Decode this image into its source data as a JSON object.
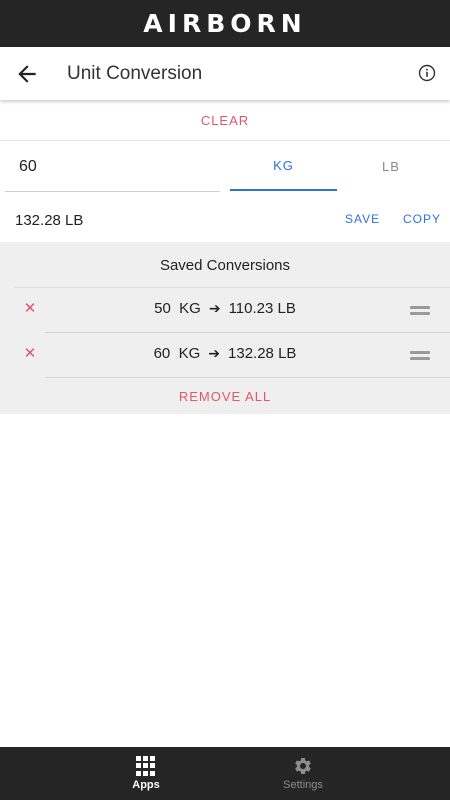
{
  "brand": {
    "name": "AIRBORN"
  },
  "header": {
    "title": "Unit Conversion",
    "back_icon": "arrow-left-icon",
    "info_icon": "info-icon"
  },
  "converter": {
    "clear_label": "CLEAR",
    "input_value": "60",
    "units": [
      {
        "label": "KG",
        "selected": true
      },
      {
        "label": "LB",
        "selected": false
      }
    ],
    "result": "132.28 LB",
    "save_label": "SAVE",
    "copy_label": "COPY"
  },
  "saved": {
    "title": "Saved Conversions",
    "items": [
      {
        "from_value": "50",
        "from_unit": "KG",
        "to_value": "110.23",
        "to_unit": "LB"
      },
      {
        "from_value": "60",
        "from_unit": "KG",
        "to_value": "132.28",
        "to_unit": "LB"
      }
    ],
    "remove_all_label": "REMOVE ALL"
  },
  "bottom_nav": {
    "items": [
      {
        "label": "Apps",
        "icon": "apps-grid-icon",
        "active": true
      },
      {
        "label": "Settings",
        "icon": "gear-icon",
        "active": false
      }
    ]
  },
  "colors": {
    "accent": "#2f72d6",
    "danger": "#e0566b",
    "dark_bar": "#252525",
    "panel": "#efefef"
  }
}
